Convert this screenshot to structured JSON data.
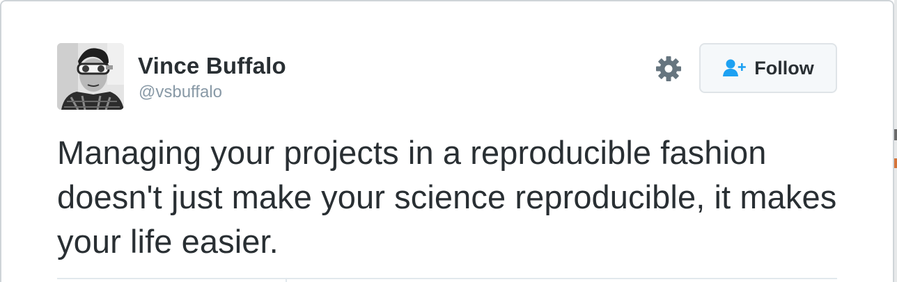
{
  "tweet": {
    "author": {
      "name": "Vince Buffalo",
      "handle": "@vsbuffalo",
      "avatar_icon": "user-avatar-photo"
    },
    "text": "Managing your projects in a reproducible fashion doesn't just make your science reproducible, it makes your life easier."
  },
  "actions": {
    "settings_icon": "gear-icon",
    "follow_icon": "add-user-icon",
    "follow_label": "Follow"
  },
  "colors": {
    "text_primary": "#292f33",
    "text_secondary": "#8899a6",
    "accent": "#1da1f2",
    "gear": "#66757f",
    "button_bg": "#f5f8fa",
    "button_border": "#dfe4e8"
  }
}
